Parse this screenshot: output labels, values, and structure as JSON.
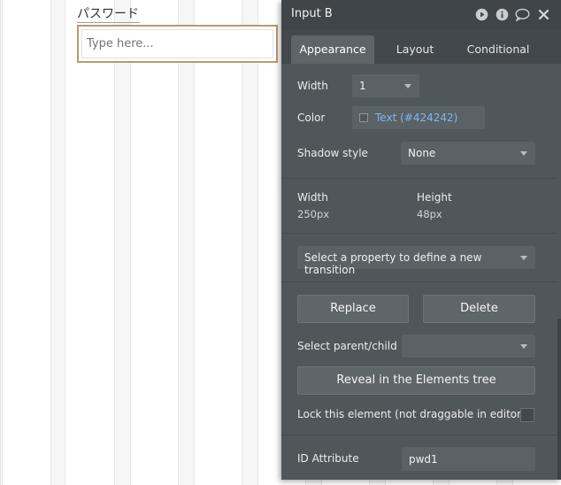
{
  "canvas": {
    "label": "パスワード",
    "input_placeholder": "Type here..."
  },
  "panel": {
    "title": "Input B",
    "header_icons": [
      "play-icon",
      "info-icon",
      "comment-icon",
      "close-icon"
    ],
    "tabs": [
      {
        "label": "Appearance",
        "active": true
      },
      {
        "label": "Layout",
        "active": false
      },
      {
        "label": "Conditional",
        "active": false
      }
    ],
    "appearance": {
      "width_label": "Width",
      "width_value": "1",
      "color_label": "Color",
      "color_value": "Text (#424242)",
      "shadow_label": "Shadow style",
      "shadow_value": "None"
    },
    "size": {
      "width_label": "Width",
      "width_value": "250px",
      "height_label": "Height",
      "height_value": "48px"
    },
    "transition_placeholder": "Select a property to define a new transition",
    "replace_label": "Replace",
    "delete_label": "Delete",
    "select_parent_label": "Select parent/child",
    "select_parent_value": "",
    "reveal_label": "Reveal in the Elements tree",
    "lock_label": "Lock this element (not draggable in editor)",
    "lock_checked": false,
    "id_attr_label": "ID Attribute",
    "id_attr_value": "pwd1"
  },
  "colors": {
    "panel_bg": "#50575b",
    "header_bg": "#3f4548",
    "link_blue": "#7fb5f0",
    "focus_border": "#b79a72"
  }
}
